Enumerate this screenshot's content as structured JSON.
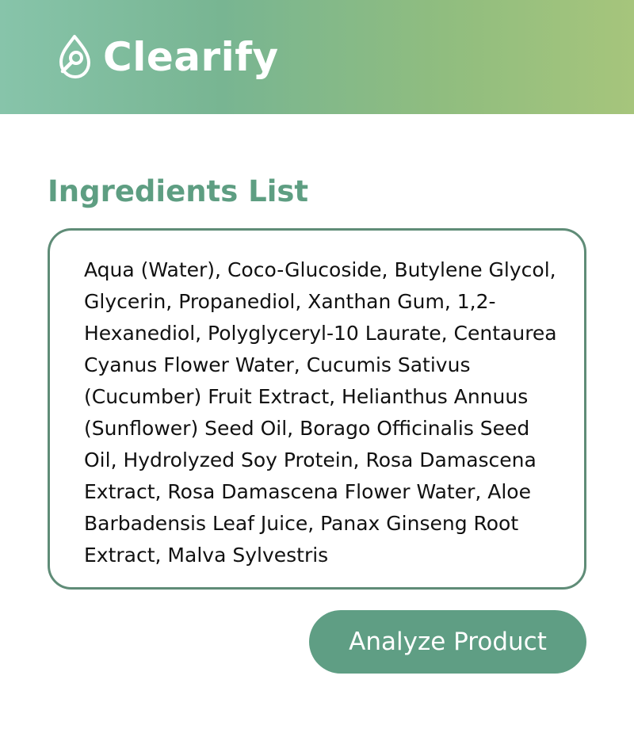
{
  "app": {
    "name": "Clearify",
    "logo_icon": "drop-magnifier-icon"
  },
  "section": {
    "title": "Ingredients List"
  },
  "ingredients": {
    "value": "Aqua (Water), Coco-Glucoside, Butylene Glycol, Glycerin, Propanediol, Xanthan Gum, 1,2-Hexanediol, Polyglyceryl-10 Laurate, Centaurea Cyanus Flower Water, Cucumis Sativus (Cucumber) Fruit Extract, Helianthus Annuus (Sunflower) Seed Oil, Borago Officinalis Seed Oil, Hydrolyzed Soy Protein, Rosa Damascena Extract, Rosa Damascena Flower Water, Aloe Barbadensis Leaf Juice, Panax Ginseng Root Extract, Malva Sylvestris"
  },
  "actions": {
    "analyze_label": "Analyze Product"
  },
  "colors": {
    "accent": "#5f9e84",
    "border": "#5f8c77",
    "header_gradient_start": "#87c4aa",
    "header_gradient_end": "#a6c57c"
  }
}
